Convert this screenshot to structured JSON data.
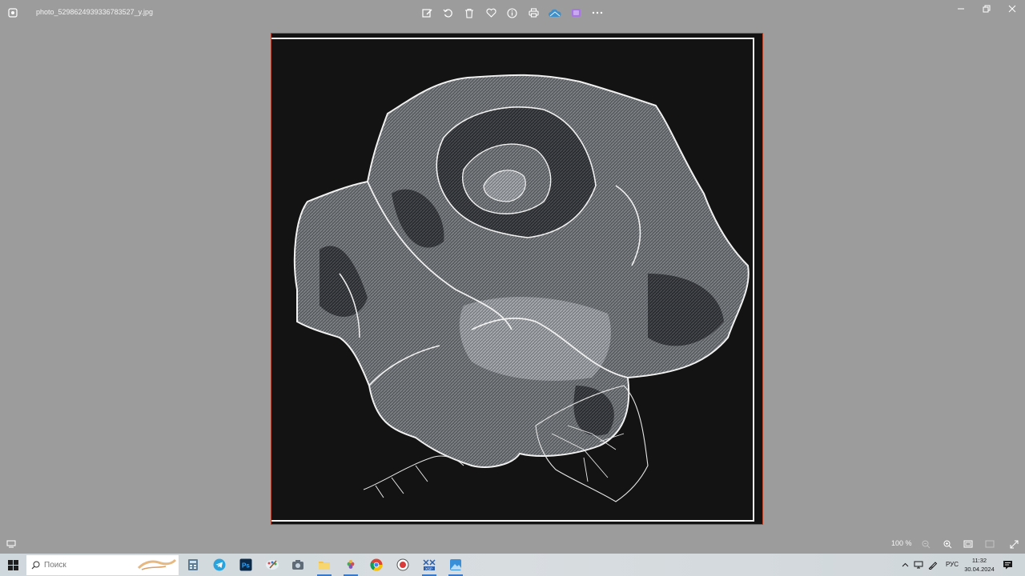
{
  "window": {
    "filename": "photo_5298624939336783527_y.jpg",
    "toolbar": [
      {
        "name": "edit-image-icon"
      },
      {
        "name": "rotate-icon"
      },
      {
        "name": "delete-icon"
      },
      {
        "name": "favorite-heart-icon"
      },
      {
        "name": "info-icon"
      },
      {
        "name": "print-icon"
      },
      {
        "name": "onedrive-cloud-icon"
      },
      {
        "name": "clipchamp-icon"
      },
      {
        "name": "more-options-icon"
      }
    ],
    "controls": [
      "minimize-icon",
      "restore-icon",
      "close-icon"
    ]
  },
  "image": {
    "subject": "cross-stitch black rose pattern",
    "background_color": "#131313",
    "frame_border_color": "#b8442b"
  },
  "statusbar": {
    "zoom": "100 %"
  },
  "taskbar": {
    "search_placeholder": "Поиск",
    "apps": [
      "calculator-icon",
      "telegram-icon",
      "photoshop-icon",
      "paint-icon",
      "camera-icon",
      "file-explorer-icon",
      "grapes-app-icon",
      "chrome-icon",
      "recorder-icon",
      "pattern-maker-icon",
      "photos-icon"
    ],
    "language": "РУС",
    "time": "11:32",
    "date": "30.04.2024"
  },
  "colors": {
    "window_bg": "#9c9c9c",
    "text_light": "#f2f2f2",
    "accent_blue": "#3a78c8"
  }
}
